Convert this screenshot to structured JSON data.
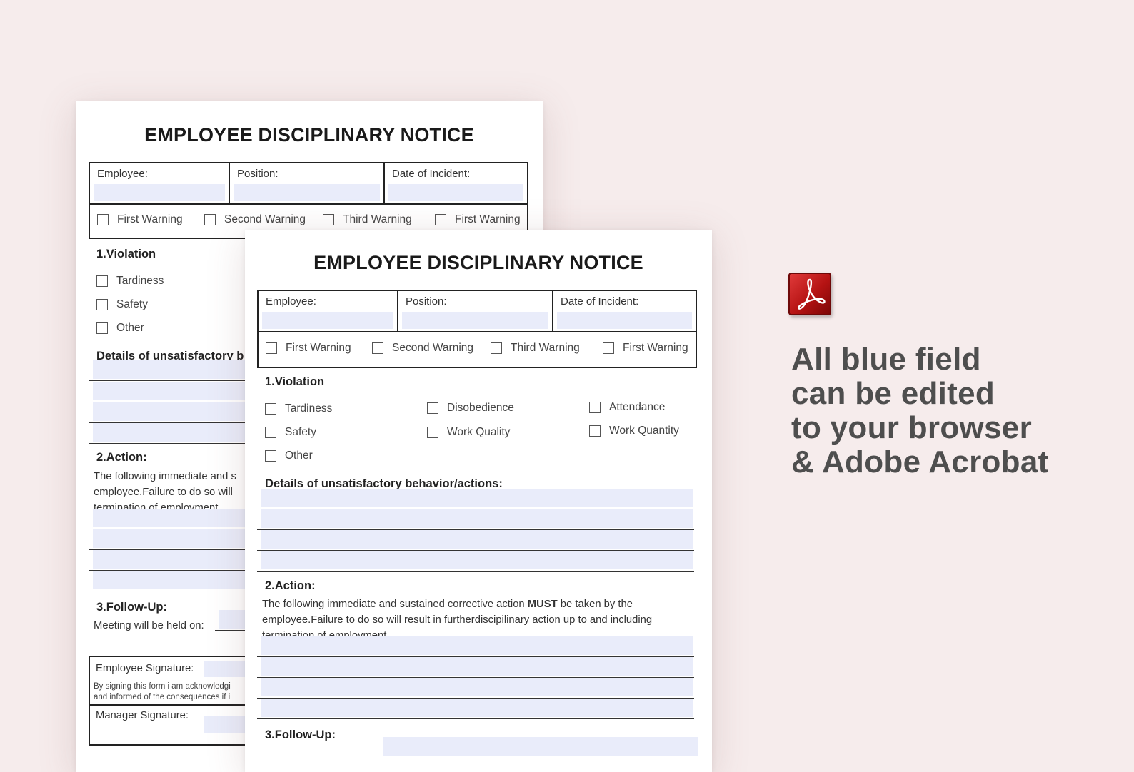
{
  "form": {
    "title": "EMPLOYEE DISCIPLINARY NOTICE",
    "employee_label": "Employee:",
    "position_label": "Position:",
    "date_label": "Date of Incident:",
    "warnings": [
      "First Warning",
      "Second Warning",
      "Third Warning",
      "First Warning"
    ],
    "violation_heading": "1.Violation",
    "violations": [
      "Tardiness",
      "Disobedience",
      "Attendance",
      "Safety",
      "Work Quality",
      "Work Quantity",
      "Other"
    ],
    "details_heading": "Details of unsatisfactory behavior/actions:",
    "action_heading": "2.Action:",
    "action_text_pre": "The following immediate and sustained corrective action ",
    "action_text_bold": "MUST",
    "action_text_post": " be taken by the employee.Failure to do so will result in furtherdiscipilinary action up to and including termination of employment",
    "followup_heading": "3.Follow-Up:",
    "meeting_label": "Meeting will be held on:",
    "employee_signature_label": "Employee Signature:",
    "acknowledge_text": "By signing this form i am acknowledgi",
    "informed_text": "and informed of the consequences if i",
    "manager_signature_label": "Manager Signature:"
  },
  "back_page": {
    "details_heading_truncated": "Details of unsatisfactory b",
    "action_line1": "The following immediate and s",
    "action_line2": "employee.Failure to do so will",
    "action_line3": "termination of employment"
  },
  "promo": {
    "icon": "adobe-acrobat-pdf-icon",
    "lines": [
      "All blue field",
      "can be edited",
      "to your browser",
      "& Adobe Acrobat"
    ]
  },
  "colors": {
    "field_fill": "#e9ecfa",
    "background": "#f6ecec",
    "promo_text": "#4e4e4e",
    "icon_red": "#c01818"
  }
}
